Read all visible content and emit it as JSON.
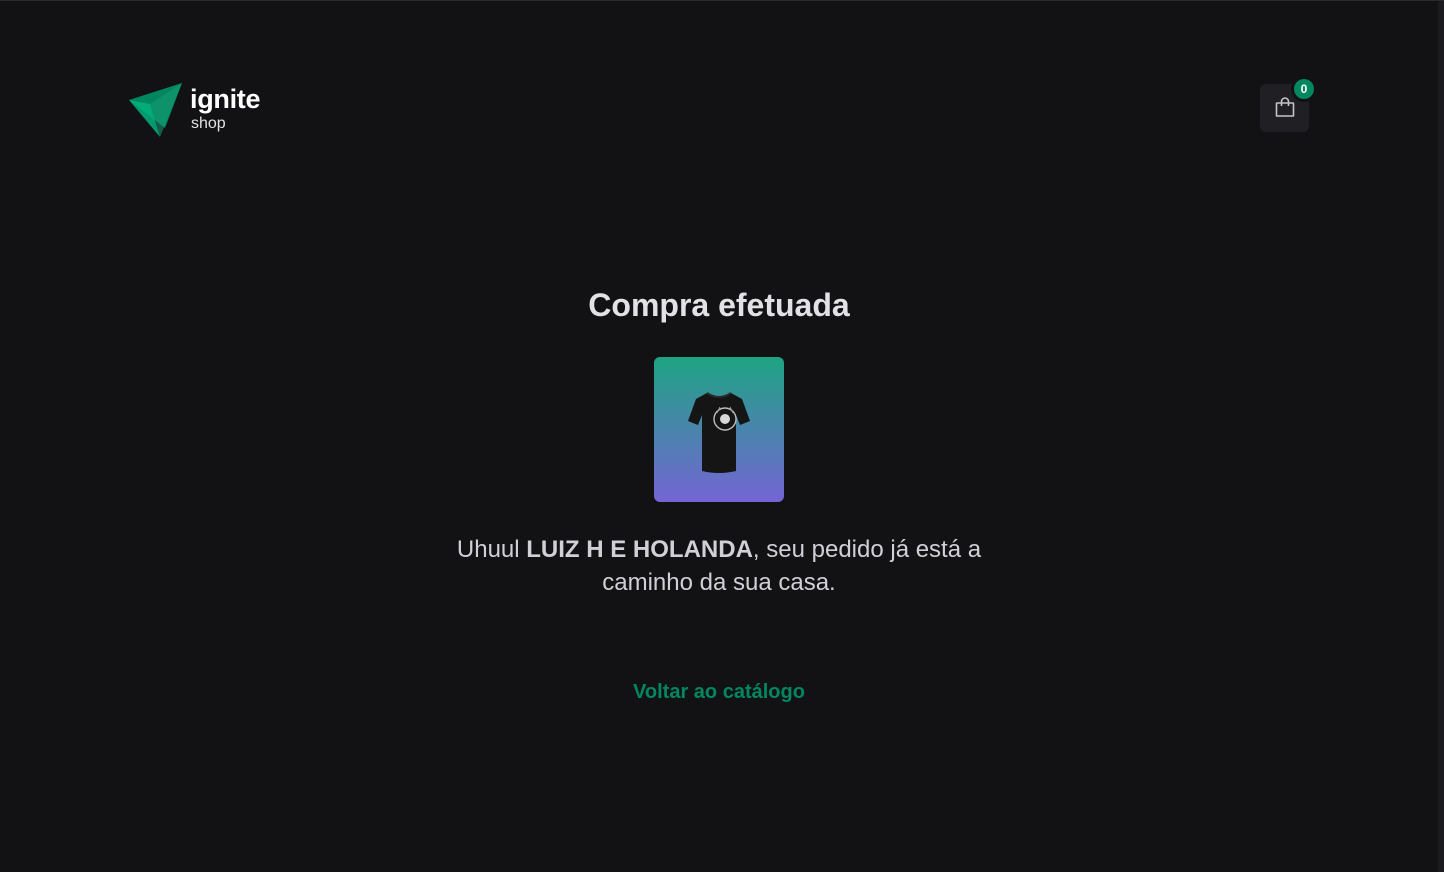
{
  "header": {
    "logo": {
      "title": "ignite",
      "subtitle": "shop",
      "icon": "ignite-triangle-logo"
    },
    "cart": {
      "icon": "shopping-bag-icon",
      "count": "0"
    }
  },
  "main": {
    "title": "Compra efetuada",
    "product_image_alt": "Camiseta preta",
    "message": {
      "prefix": "Uhuul ",
      "customer_name": "LUIZ H E HOLANDA",
      "suffix": ", seu pedido já está a caminho da sua casa."
    },
    "back_link_label": "Voltar ao catálogo"
  },
  "colors": {
    "background": "#121214",
    "brand_green": "#00875f",
    "cart_button_bg": "#202024",
    "gradient_start": "#1ea483",
    "gradient_end": "#7465d4"
  }
}
